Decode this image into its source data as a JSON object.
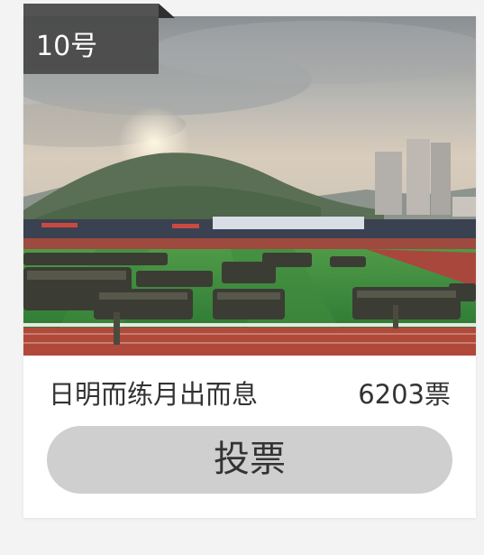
{
  "card": {
    "badge_label": "10号",
    "title": "日明而练月出而息",
    "votes": "6203票",
    "vote_button_label": "投票"
  },
  "colors": {
    "page_background": "#f3f3f3",
    "badge": "#4a4a4a",
    "button": "#cfcfcf",
    "text": "#333333"
  }
}
